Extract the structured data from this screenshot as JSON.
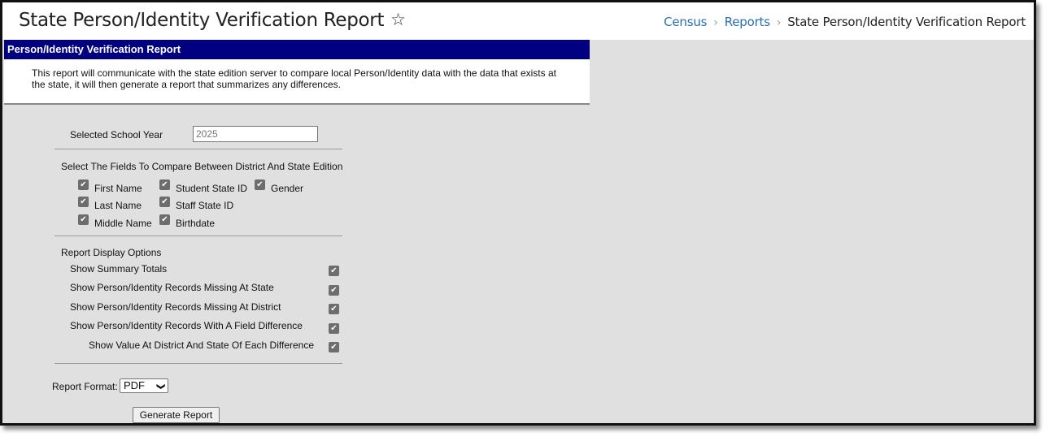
{
  "header": {
    "title": "State Person/Identity Verification Report",
    "star_icon": "star-outline-icon",
    "breadcrumb": [
      {
        "label": "Census"
      },
      {
        "label": "Reports"
      },
      {
        "label": "State Person/Identity Verification Report"
      }
    ],
    "breadcrumb_separator": "›"
  },
  "panel": {
    "title": "Person/Identity Verification Report",
    "description": "This report will communicate with the state edition server to compare local Person/Identity data with the data that exists at the state, it will then generate a report that summarizes any differences."
  },
  "form": {
    "school_year_label": "Selected School Year",
    "school_year_value": "2025",
    "fields_section_label": "Select The Fields To Compare Between District And State Edition",
    "fields": [
      {
        "label": "First Name",
        "checked": true
      },
      {
        "label": "Student State ID",
        "checked": true
      },
      {
        "label": "Gender",
        "checked": true
      },
      {
        "label": "Last Name",
        "checked": true
      },
      {
        "label": "Staff State ID",
        "checked": true
      },
      {
        "label": "Middle Name",
        "checked": true
      },
      {
        "label": "Birthdate",
        "checked": true
      }
    ],
    "display_section_label": "Report Display Options",
    "display_options": [
      {
        "label": "Show Summary Totals",
        "checked": true
      },
      {
        "label": "Show Person/Identity Records Missing At State",
        "checked": true
      },
      {
        "label": "Show Person/Identity Records Missing At District",
        "checked": true
      },
      {
        "label": "Show Person/Identity Records With A Field Difference",
        "checked": true
      },
      {
        "label": "Show Value At District And State Of Each Difference",
        "checked": true
      }
    ],
    "report_format_label": "Report Format:",
    "report_format_value": "PDF",
    "generate_button_label": "Generate Report"
  },
  "colors": {
    "panel_header_bg": "#000080",
    "breadcrumb_link": "#2a6fb0",
    "page_bg": "#e0e0e0"
  }
}
